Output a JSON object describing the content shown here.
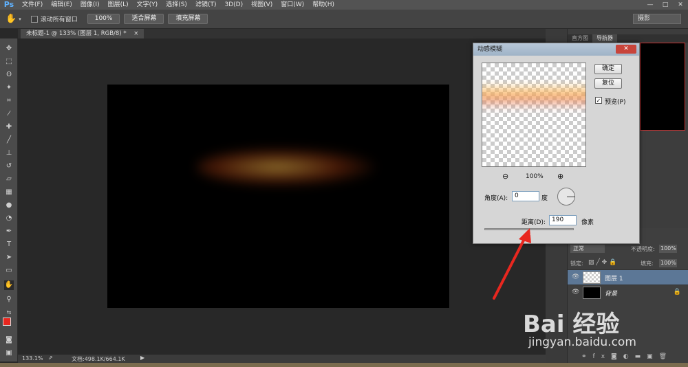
{
  "app": {
    "logo": "Ps"
  },
  "menu": [
    "文件(F)",
    "编辑(E)",
    "图像(I)",
    "图层(L)",
    "文字(Y)",
    "选择(S)",
    "滤镜(T)",
    "3D(D)",
    "视图(V)",
    "窗口(W)",
    "帮助(H)"
  ],
  "window_controls": {
    "minimize": "—",
    "maximize": "□",
    "close": "✕"
  },
  "options_bar": {
    "scroll_all_label": "滚动所有窗口",
    "zoom_100": "100%",
    "fit_screen": "适合屏幕",
    "fill_screen": "填充屏幕",
    "workspace": "摄影"
  },
  "document_tab": {
    "title": "未标题-1 @ 133% (图层 1, RGB/8) *",
    "close": "×"
  },
  "status_bar": {
    "zoom": "133.1%",
    "doc_info": "文档:498.1K/664.1K"
  },
  "panels": {
    "tabs": [
      "直方图",
      "导航器"
    ],
    "layers": {
      "blend_mode": "正常",
      "opacity_label": "不透明度:",
      "opacity_value": "100%",
      "lock_label": "锁定:",
      "fill_label": "填充:",
      "fill_value": "100%",
      "items": [
        {
          "name": "图层 1",
          "selected": true
        },
        {
          "name": "背景",
          "locked": true
        }
      ]
    }
  },
  "dialog": {
    "title": "动感模糊",
    "close": "✕",
    "ok": "确定",
    "reset": "复位",
    "preview_label": "预览(P)",
    "preview_checked": true,
    "zoom_percent": "100%",
    "zoom_out": "⊖",
    "zoom_in": "⊕",
    "angle_label": "角度(A):",
    "angle_value": "0",
    "angle_unit": "度",
    "distance_label": "距离(D):",
    "distance_value": "190",
    "distance_unit": "像素"
  },
  "watermark": {
    "brand": "Bai 经验",
    "url": "jingyan.baidu.com"
  },
  "colors": {
    "foreground": "#e8271f",
    "background": "#000000",
    "accent": "#5fb2ff"
  }
}
